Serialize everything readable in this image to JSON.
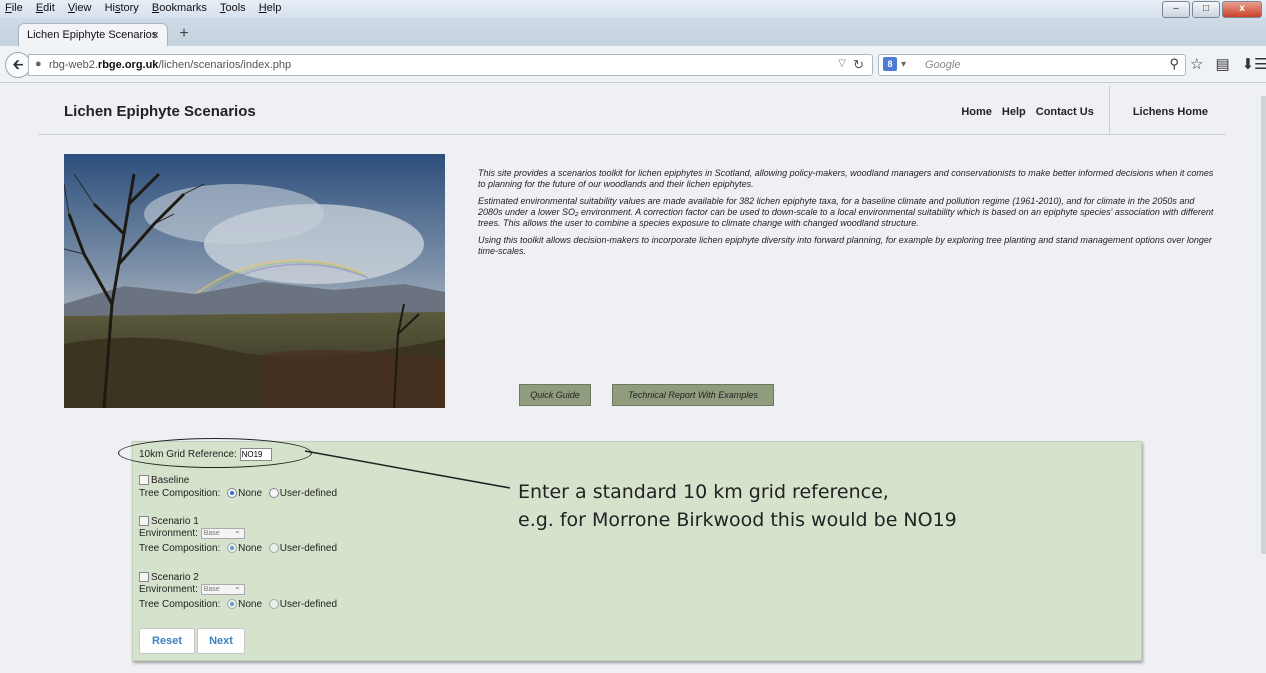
{
  "browser": {
    "menu": [
      {
        "pre": "",
        "ul": "F",
        "post": "ile"
      },
      {
        "pre": "",
        "ul": "E",
        "post": "dit"
      },
      {
        "pre": "",
        "ul": "V",
        "post": "iew"
      },
      {
        "pre": "Hi",
        "ul": "s",
        "post": "tory"
      },
      {
        "pre": "",
        "ul": "B",
        "post": "ookmarks"
      },
      {
        "pre": "",
        "ul": "T",
        "post": "ools"
      },
      {
        "pre": "",
        "ul": "H",
        "post": "elp"
      }
    ],
    "tab_title": "Lichen Epiphyte Scenarios",
    "tab_close": "×",
    "new_tab": "+",
    "url_prefix": "rbg-web2.",
    "url_domain": "rbge.org.uk",
    "url_path": "/lichen/scenarios/index.php",
    "search_placeholder": "Google"
  },
  "site": {
    "title": "Lichen Epiphyte Scenarios",
    "nav": {
      "home": "Home",
      "help": "Help",
      "contact": "Contact Us",
      "lichens_home": "Lichens Home"
    },
    "intro_p1": "This site provides a scenarios toolkit for lichen epiphytes in Scotland, allowing policy-makers, woodland managers and conservationists to make better informed decisions when it comes to planning for the future of our woodlands and their lichen epiphytes.",
    "intro_p2": "Estimated environmental suitability values are made available for 382 lichen epiphyte taxa, for a baseline climate and pollution regime (1961-2010), and for climate in the 2050s and 2080s under a lower SO₂ environment. A correction factor can be used to down-scale to a local environmental suitability which is based on an epiphyte species' association with different trees. This allows the user to combine a species exposure to climate change with changed woodland structure.",
    "intro_p3": "Using this toolkit allows decision-makers to incorporate lichen epiphyte diversity into forward planning, for example by exploring tree planting and stand management options over longer time-scales.",
    "quick_guide": "Quick Guide",
    "tech_report": "Technical Report With Examples"
  },
  "form": {
    "grid_label": "10km Grid Reference:",
    "grid_value": "NO19",
    "baseline_label": "Baseline",
    "tree_comp_label": "Tree Composition:",
    "none_label": "None",
    "user_defined_label": "User-defined",
    "scenario1_label": "Scenario 1",
    "scenario2_label": "Scenario 2",
    "environment_label": "Environment:",
    "env_value": "Base",
    "reset": "Reset",
    "next": "Next"
  },
  "callout": {
    "line1": "Enter a standard 10 km grid reference,",
    "line2": "e.g. for Morrone Birkwood this would be NO19"
  }
}
